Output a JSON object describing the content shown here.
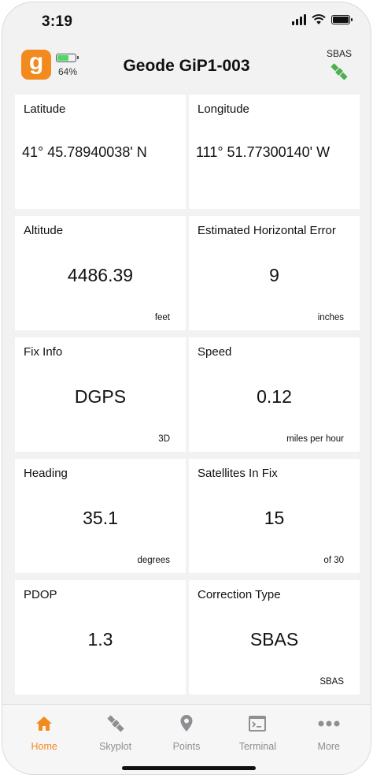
{
  "status_bar": {
    "time": "3:19"
  },
  "header": {
    "logo_letter": "g",
    "device_battery_percent": "64%",
    "device_battery_level": 0.64,
    "title": "Geode GiP1-003",
    "correction_label": "SBAS"
  },
  "cards": [
    {
      "label": "Latitude",
      "value": "41° 45.78940038' N",
      "unit": ""
    },
    {
      "label": "Longitude",
      "value": "111° 51.77300140' W",
      "unit": ""
    },
    {
      "label": "Altitude",
      "value": "4486.39",
      "unit": "feet"
    },
    {
      "label": "Estimated Horizontal Error",
      "value": "9",
      "unit": "inches"
    },
    {
      "label": "Fix Info",
      "value": "DGPS",
      "unit": "3D"
    },
    {
      "label": "Speed",
      "value": "0.12",
      "unit": "miles per hour"
    },
    {
      "label": "Heading",
      "value": "35.1",
      "unit": "degrees"
    },
    {
      "label": "Satellites In Fix",
      "value": "15",
      "unit": "of 30"
    },
    {
      "label": "PDOP",
      "value": "1.3",
      "unit": ""
    },
    {
      "label": "Correction Type",
      "value": "SBAS",
      "unit": "SBAS"
    }
  ],
  "tabs": [
    {
      "label": "Home",
      "icon": "home-icon",
      "active": true
    },
    {
      "label": "Skyplot",
      "icon": "satellite-icon",
      "active": false
    },
    {
      "label": "Points",
      "icon": "map-pin-icon",
      "active": false
    },
    {
      "label": "Terminal",
      "icon": "terminal-icon",
      "active": false
    },
    {
      "label": "More",
      "icon": "more-dots-icon",
      "active": false
    }
  ],
  "colors": {
    "accent": "#f28a1e",
    "battery_green": "#4cd964",
    "satellite_green": "#4caf50",
    "tab_inactive": "#8e8e93"
  }
}
